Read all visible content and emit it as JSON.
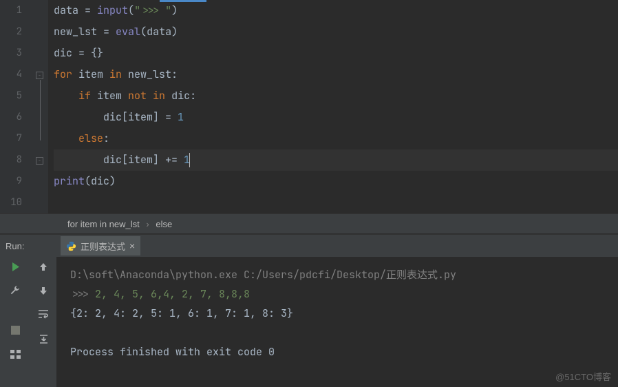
{
  "code": {
    "lines": [
      "1",
      "2",
      "3",
      "4",
      "5",
      "6",
      "7",
      "8",
      "9",
      "10"
    ],
    "l1_var": "data",
    "l1_eq": " = ",
    "l1_fn": "input",
    "l1_p1": "(",
    "l1_str": "\">>> \"",
    "l1_p2": ")",
    "l2_var": "new_lst",
    "l2_eq": " = ",
    "l2_fn": "eval",
    "l2_p1": "(",
    "l2_arg": "data",
    "l2_p2": ")",
    "l3_var": "dic",
    "l3_eq": " = {}",
    "l4_kw1": "for",
    "l4_var": " item ",
    "l4_kw2": "in",
    "l4_var2": " new_lst:",
    "l5_pad": "    ",
    "l5_kw1": "if",
    "l5_var": " item ",
    "l5_kw2": "not in",
    "l5_var2": " dic:",
    "l6_pad": "        ",
    "l6_var": "dic[item] = ",
    "l6_num": "1",
    "l7_pad": "    ",
    "l7_kw": "else",
    "l7_colon": ":",
    "l8_pad": "        ",
    "l8_var": "dic[item] += ",
    "l8_num": "1",
    "l9_fn": "print",
    "l9_p1": "(",
    "l9_arg": "dic",
    "l9_p2": ")"
  },
  "breadcrumb": {
    "item1": "for item in new_lst",
    "item2": "else"
  },
  "run": {
    "label": "Run:",
    "tab_name": "正则表达式"
  },
  "console": {
    "path": "D:\\soft\\Anaconda\\python.exe C:/Users/pdcfi/Desktop/正则表达式.py",
    "prompt": ">>> ",
    "input": "2, 4, 5, 6,4, 2, 7, 8,8,8",
    "output": "{2: 2, 4: 2, 5: 1, 6: 1, 7: 1, 8: 3}",
    "exit": "Process finished with exit code 0"
  },
  "watermark": "@51CTO博客"
}
